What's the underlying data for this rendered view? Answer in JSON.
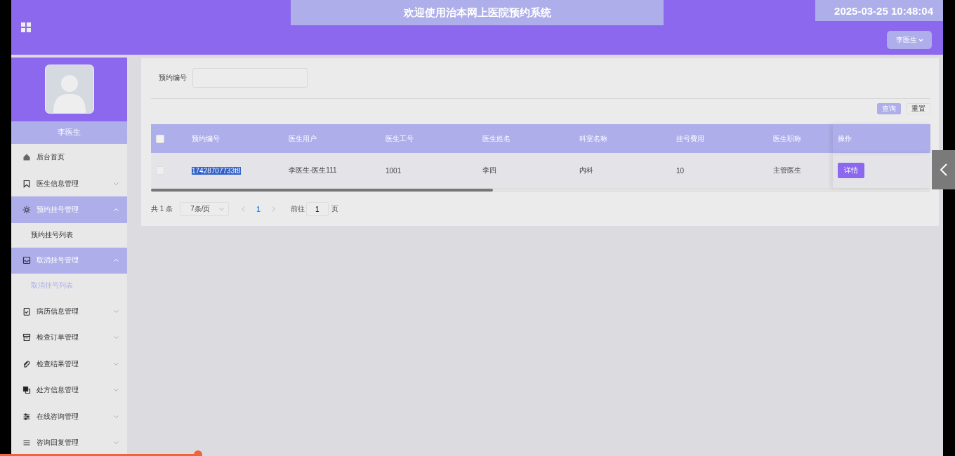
{
  "header": {
    "title": "欢迎使用治本网上医院预约系统",
    "clock": "2025-03-25 10:48:04",
    "user_menu": "李医生"
  },
  "sidebar": {
    "user_name": "李医生",
    "items": [
      {
        "kind": "link",
        "label": "后台首页"
      },
      {
        "kind": "group",
        "label": "医生信息管理",
        "expanded": false
      },
      {
        "kind": "group",
        "label": "预约挂号管理",
        "expanded": true,
        "children": [
          {
            "label": "预约挂号列表",
            "selected": false
          }
        ]
      },
      {
        "kind": "group",
        "label": "取消挂号管理",
        "expanded": true,
        "children": [
          {
            "label": "取消挂号列表",
            "selected": true
          }
        ]
      },
      {
        "kind": "group",
        "label": "病历信息管理",
        "expanded": false
      },
      {
        "kind": "group",
        "label": "检查订单管理",
        "expanded": false
      },
      {
        "kind": "group",
        "label": "检查结果管理",
        "expanded": false
      },
      {
        "kind": "group",
        "label": "处方信息管理",
        "expanded": false
      },
      {
        "kind": "group",
        "label": "在线咨询管理",
        "expanded": false
      },
      {
        "kind": "group",
        "label": "咨询回复管理",
        "expanded": false
      }
    ]
  },
  "search": {
    "label": "预约编号",
    "buttons": [
      {
        "label": "查询",
        "kind": "primary"
      },
      {
        "label": "重置",
        "kind": "plain"
      }
    ]
  },
  "table": {
    "select_all_checked": false,
    "columns": [
      "预约编号",
      "医生用户",
      "医生工号",
      "医生姓名",
      "科室名称",
      "挂号费用",
      "医生职称",
      "操作"
    ],
    "rows": [
      {
        "checked": false,
        "cells": [
          "17428707733t8",
          "李医生-医生111",
          "1001",
          "李四",
          "内科",
          "10",
          "主管医生"
        ],
        "highlighted": true,
        "action": "详情"
      }
    ]
  },
  "pagination": {
    "total": "共 1 条",
    "page_size": "7条/页",
    "pages": [
      {
        "label": "1",
        "selected": true
      }
    ],
    "goto_label": "前往",
    "goto_value": "1",
    "goto_suffix": "页"
  },
  "progress_bar": {
    "level": 0.21
  }
}
